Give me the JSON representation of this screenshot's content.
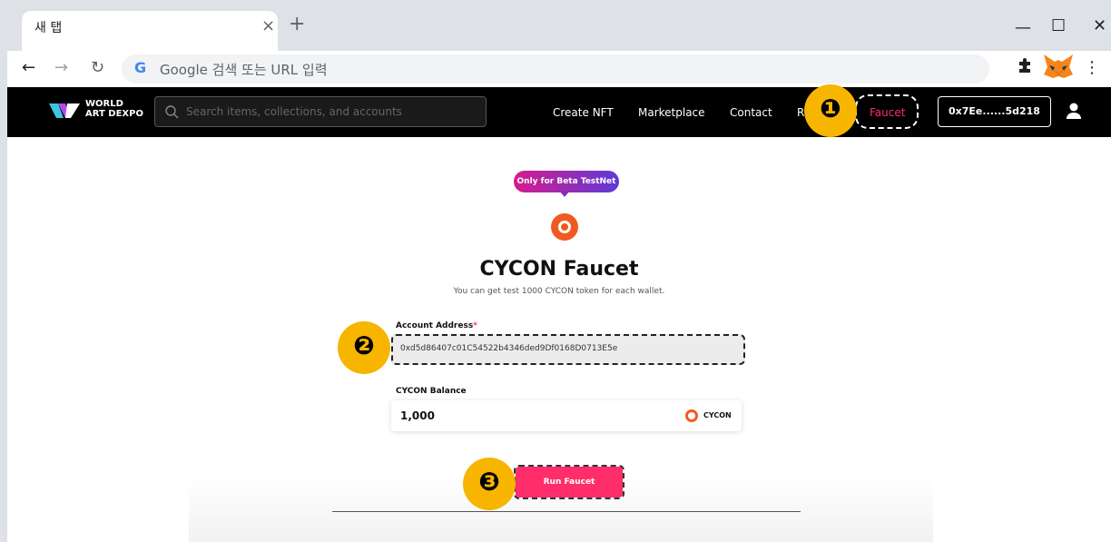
{
  "browser": {
    "tab_title": "새 탭",
    "tab_close": "×",
    "new_tab": "+",
    "minimize": "—",
    "maximize": "☐",
    "close": "✕",
    "omnibox_placeholder": "Google 검색 또는 URL 입력",
    "google_logo": "G",
    "menu": "⋮"
  },
  "site": {
    "logo_line1": "WORLD",
    "logo_line2": "ART DEXPO",
    "search_placeholder": "Search items, collections, and accounts",
    "nav": {
      "create_nft": "Create NFT",
      "marketplace": "Marketplace",
      "contact": "Contact",
      "partial": "R",
      "faucet": "Faucet"
    },
    "wallet_address": "0x7Ee......5d218"
  },
  "annotations": {
    "step1": "❶",
    "step2": "❷",
    "step3": "❸"
  },
  "faucet": {
    "badge": "Only for Beta TestNet",
    "title": "CYCON Faucet",
    "subtitle": "You can get test 1000 CYCON token for each wallet.",
    "account_label": "Account Address",
    "required_mark": "*",
    "account_value": "0xd5d86407c01C54522b4346ded9Df0168D0713E5e",
    "balance_label": "CYCON Balance",
    "balance_value": "1,000",
    "balance_unit": "CYCON",
    "run_button": "Run Faucet"
  },
  "colors": {
    "accent": "#ff2d6a",
    "annotation": "#f7b500",
    "cycon": "#f05a22"
  }
}
